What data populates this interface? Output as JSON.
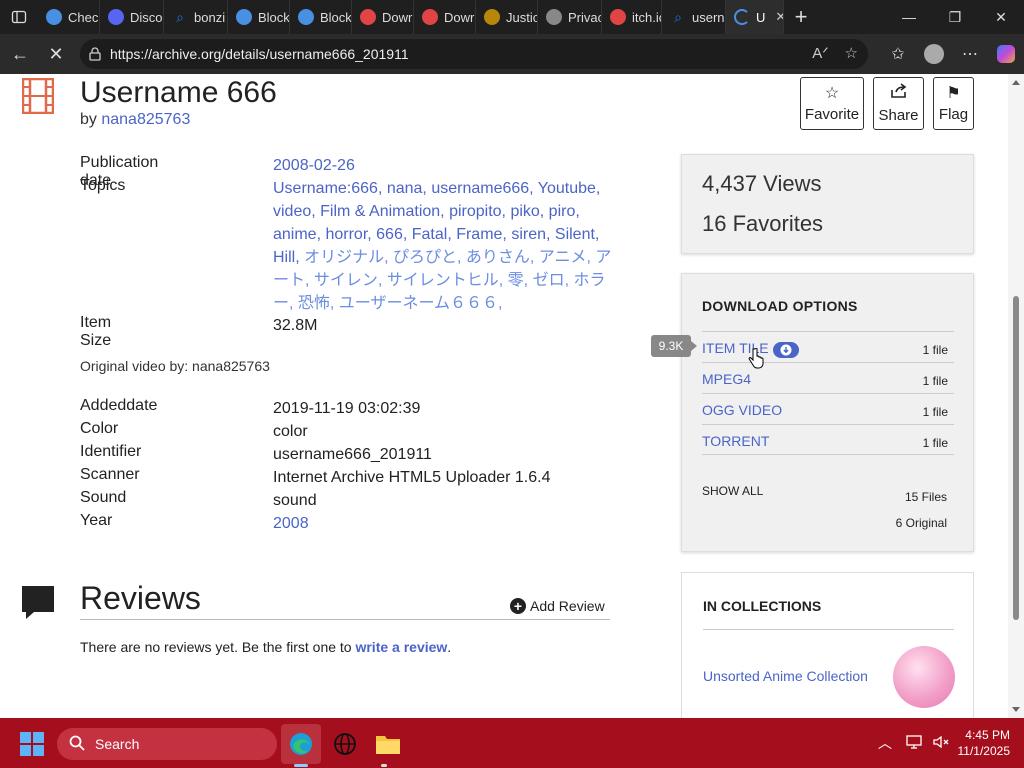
{
  "browser": {
    "tabs": [
      {
        "title": "Chec",
        "fav_color": "#4a90e2",
        "fav": "globe"
      },
      {
        "title": "Disco",
        "fav_color": "#5865f2",
        "fav": "discord"
      },
      {
        "title": "bonzi",
        "fav_color": "#1f6feb",
        "fav": "search"
      },
      {
        "title": "Block",
        "fav_color": "#4a90e2",
        "fav": "globe"
      },
      {
        "title": "Block",
        "fav_color": "#4a90e2",
        "fav": "globe"
      },
      {
        "title": "Dowr",
        "fav_color": "#e04444",
        "fav": "itch"
      },
      {
        "title": "Dowr",
        "fav_color": "#e04444",
        "fav": "itch"
      },
      {
        "title": "Justic",
        "fav_color": "#b8860b",
        "fav": "seal"
      },
      {
        "title": "Privacy err",
        "fav_color": "#888888",
        "fav": "warning"
      },
      {
        "title": "itch.ic",
        "fav_color": "#e04444",
        "fav": "itch"
      },
      {
        "title": "usern",
        "fav_color": "#1f6feb",
        "fav": "search"
      },
      {
        "title": "U",
        "fav_color": "#4a90e2",
        "fav": "loading",
        "active": true
      }
    ],
    "new_tab": "+",
    "url": "https://archive.org/details/username666_201911"
  },
  "item": {
    "title": "Username 666",
    "by_prefix": "by",
    "author": "nana825763",
    "actions": {
      "favorite": "Favorite",
      "share": "Share",
      "flag": "Flag"
    }
  },
  "metadata": {
    "publication_date_label": "Publication date",
    "publication_date": "2008-02-26",
    "topics_label": "Topics",
    "topics_latin": "Username:666, nana, username666, Youtube, video, Film & Animation, piropito, piko, piro, anime, horror, 666, Fatal, Frame, siren, Silent, Hill,",
    "topics_japanese": "オリジナル, ぴろぴと, ありさん, アニメ, アート, サイレン, サイレントヒル, 零, ゼロ, ホラー, 恐怖, ユーザーネーム６６６,",
    "item_size_label": "Item Size",
    "item_size": "32.8M",
    "original_video_by": "Original video by: nana825763",
    "addeddate_label": "Addeddate",
    "addeddate": "2019-11-19 03:02:39",
    "color_label": "Color",
    "color": "color",
    "identifier_label": "Identifier",
    "identifier": "username666_201911",
    "scanner_label": "Scanner",
    "scanner": "Internet Archive HTML5 Uploader 1.6.4",
    "sound_label": "Sound",
    "sound": "sound",
    "year_label": "Year",
    "year": "2008"
  },
  "stats": {
    "views": "4,437 Views",
    "favorites": "16 Favorites"
  },
  "downloads": {
    "heading": "DOWNLOAD OPTIONS",
    "tooltip": "9.3K",
    "rows": [
      {
        "name": "ITEM TILE",
        "count": "1 file"
      },
      {
        "name": "MPEG4",
        "count": "1 file"
      },
      {
        "name": "OGG VIDEO",
        "count": "1 file"
      },
      {
        "name": "TORRENT",
        "count": "1 file"
      }
    ],
    "show_all": "SHOW ALL",
    "total_files": "15 Files",
    "original": "6 Original"
  },
  "collections": {
    "heading": "IN COLLECTIONS",
    "items": [
      {
        "name": "Unsorted Anime Collection"
      }
    ]
  },
  "reviews": {
    "title": "Reviews",
    "add_label": "Add Review",
    "empty_text": "There are no reviews yet. Be the first one to",
    "write_link": "write a review",
    "period": "."
  },
  "taskbar": {
    "search_placeholder": "Search",
    "time": "4:45 PM",
    "date": "11/1/2025"
  }
}
